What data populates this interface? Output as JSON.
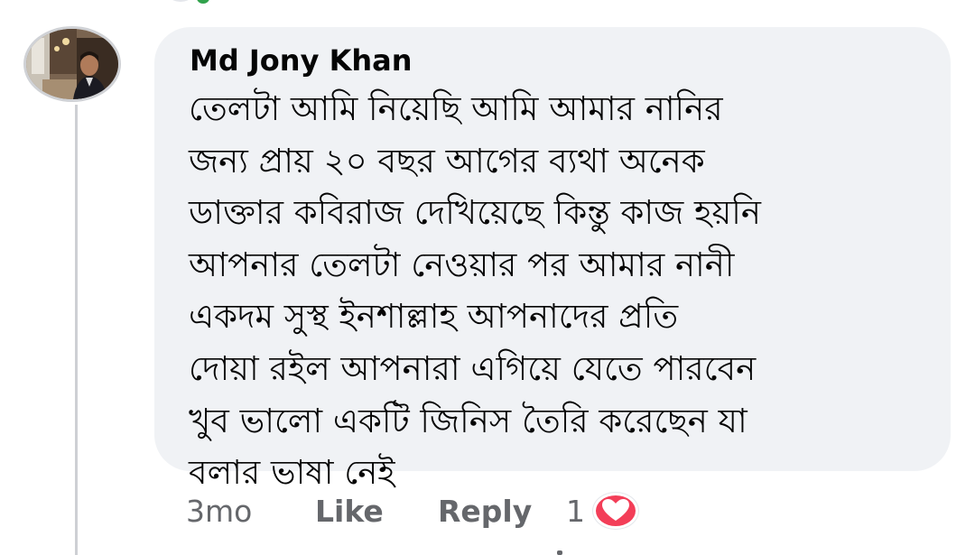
{
  "comment": {
    "author": "Md Jony Khan",
    "text_lines": [
      "তেলটা আমি নিয়েছি আমি আমার নানির",
      "জন্য প্রায় ২০ বছর আগের ব্যথা অনেক",
      "ডাক্তার কবিরাজ দেখিয়েছে কিন্তু কাজ হয়নি",
      "আপনার তেলটা  নেওয়ার পর আমার নানী",
      "একদম সুস্থ ইনশাল্লাহ আপনাদের প্রতি",
      "দোয়া রইল আপনারা এগিয়ে যেতে পারবেন",
      "খুব ভালো একটি জিনিস তৈরি করেছেন যা",
      "বলার ভাষা নেই"
    ],
    "timestamp": "3mo",
    "like_label": "Like",
    "reply_label": "Reply",
    "reaction_count": "1",
    "reaction_icon": "heart-icon",
    "colors": {
      "bubble": "#f0f2f5",
      "meta_text": "#65676b",
      "heart": "#f33e58",
      "presence": "#31a24c"
    }
  }
}
